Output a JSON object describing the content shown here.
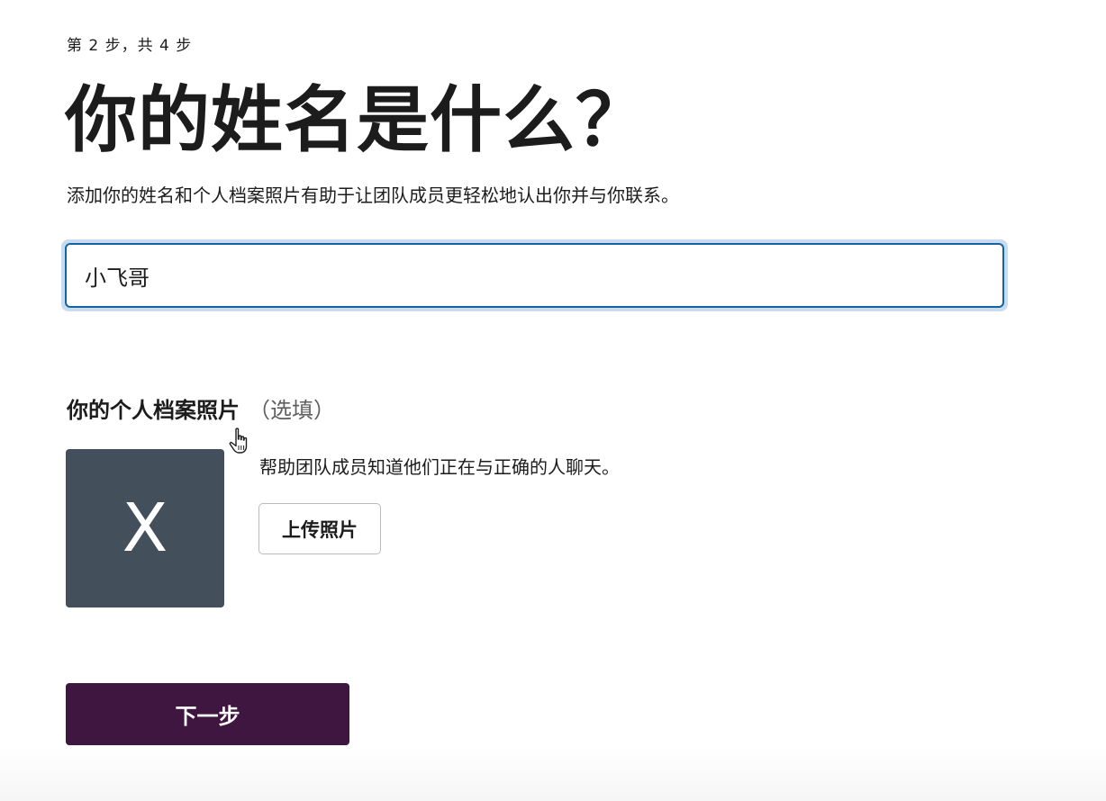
{
  "step_indicator": "第 2 步，共 4 步",
  "title": "你的姓名是什么？",
  "subtitle": "添加你的姓名和个人档案照片有助于让团队成员更轻松地认出你并与你联系。",
  "name_field": {
    "value": "小飞哥"
  },
  "profile_photo": {
    "heading": "你的个人档案照片",
    "optional_label": "（选填）",
    "avatar_initial": "X",
    "avatar_color": "#434f5a",
    "help_text": "帮助团队成员知道他们正在与正确的人聊天。",
    "upload_label": "上传照片"
  },
  "next_button": {
    "label": "下一步",
    "color": "#3f163f"
  },
  "icons": {
    "cursor": "hand-pointer-icon"
  }
}
